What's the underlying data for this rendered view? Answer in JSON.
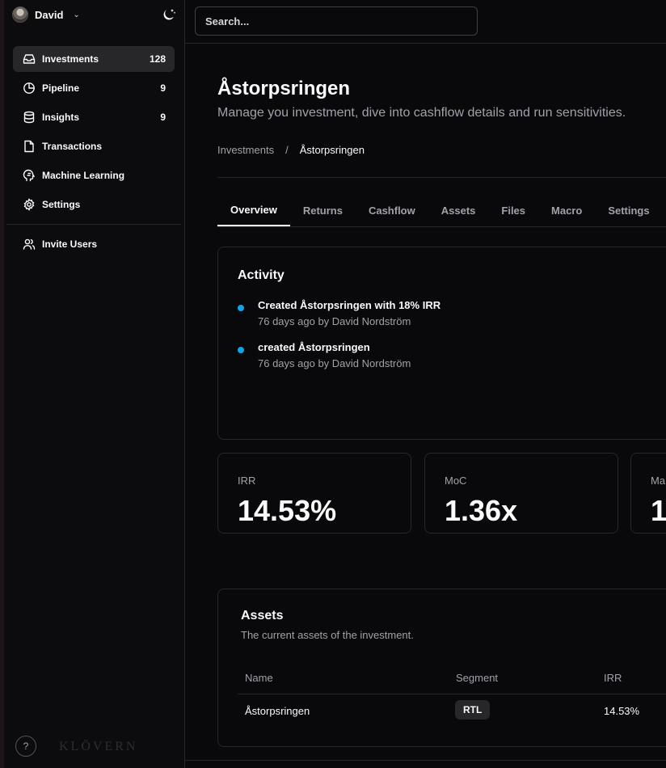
{
  "user": {
    "name": "David"
  },
  "sidebar": {
    "items": [
      {
        "label": "Investments",
        "count": "128",
        "icon": "inbox-icon",
        "active": true
      },
      {
        "label": "Pipeline",
        "count": "9",
        "icon": "pie-chart-icon"
      },
      {
        "label": "Insights",
        "count": "9",
        "icon": "database-icon"
      },
      {
        "label": "Transactions",
        "count": "",
        "icon": "file-icon"
      },
      {
        "label": "Machine Learning",
        "count": "",
        "icon": "brain-icon"
      },
      {
        "label": "Settings",
        "count": "",
        "icon": "gear-icon"
      }
    ],
    "invite_label": "Invite Users",
    "help_label": "?",
    "brand": "KLÖVERN"
  },
  "search": {
    "placeholder": "Search..."
  },
  "page": {
    "title": "Åstorpsringen",
    "subtitle": "Manage you investment, dive into cashflow details and run sensitivities.",
    "breadcrumb": {
      "parent": "Investments",
      "separator": "/",
      "current": "Åstorpsringen"
    }
  },
  "tabs": [
    "Overview",
    "Returns",
    "Cashflow",
    "Assets",
    "Files",
    "Macro",
    "Settings"
  ],
  "activity": {
    "title": "Activity",
    "items": [
      {
        "text": "Created Åstorpsringen with 18% IRR",
        "meta": "76 days ago by David Nordström"
      },
      {
        "text": "created Åstorpsringen",
        "meta": "76 days ago by David Nordström"
      }
    ]
  },
  "metrics": [
    {
      "label": "IRR",
      "value": "14.53%"
    },
    {
      "label": "MoC",
      "value": "1.36x"
    },
    {
      "label": "Ma",
      "value": "1"
    }
  ],
  "assets": {
    "title": "Assets",
    "subtitle": "The current assets of the investment.",
    "columns": [
      "Name",
      "Segment",
      "IRR"
    ],
    "rows": [
      {
        "name": "Åstorpsringen",
        "segment": "RTL",
        "irr": "14.53%"
      }
    ]
  },
  "colors": {
    "accent_dot": "#0ea5e9",
    "background": "#09090b",
    "border": "#27272a"
  }
}
